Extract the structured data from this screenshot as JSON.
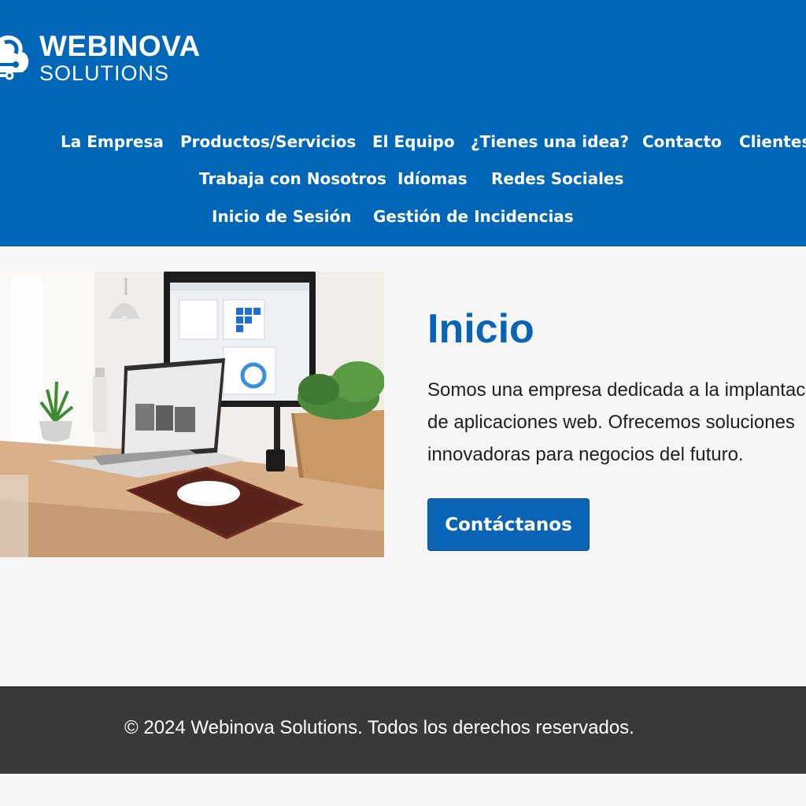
{
  "brand": {
    "name": "WEBINOVA",
    "tagline": "SOLUTIONS",
    "primary_color": "#0066b8",
    "accent_color": "#0a64b6"
  },
  "nav": {
    "items": [
      {
        "label": "La Empresa"
      },
      {
        "label": "Productos/Servicios"
      },
      {
        "label": "El Equipo"
      },
      {
        "label": "¿Tienes una idea?"
      },
      {
        "label": "Contacto"
      },
      {
        "label": "Clientes"
      },
      {
        "label": "Trabaja con Nosotros"
      },
      {
        "label": "Idíomas"
      },
      {
        "label": "Redes Sociales"
      },
      {
        "label": "Inicio de Sesión"
      },
      {
        "label": "Gestión de Incidencias"
      }
    ]
  },
  "hero": {
    "image_icon": "desk-workspace-photo",
    "title": "Inicio",
    "description_lines": [
      "Somos una empresa dedicada a la implantación",
      "de aplicaciones web. Ofrecemos soluciones",
      "innovadoras para negocios del futuro."
    ],
    "cta_label": "Contáctanos"
  },
  "footer": {
    "text": "© 2024 Webinova Solutions. Todos los derechos reservados.",
    "background_color": "#393939"
  }
}
